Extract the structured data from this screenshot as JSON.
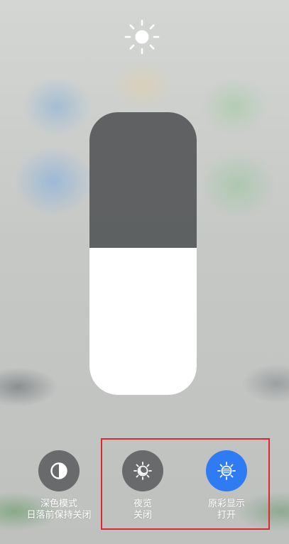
{
  "brightness": {
    "level_fraction": 0.52,
    "icon": "sun-icon"
  },
  "controls": [
    {
      "id": "dark-mode",
      "icon": "dark-mode-icon",
      "title": "深色模式",
      "status": "日落前保持关闭",
      "active": false
    },
    {
      "id": "night-vision",
      "icon": "night-vision-icon",
      "title": "夜览",
      "status": "关闭",
      "active": false
    },
    {
      "id": "true-tone",
      "icon": "true-tone-icon",
      "title": "原彩显示",
      "status": "打开",
      "active": true
    }
  ],
  "colors": {
    "active_button": "#2f7bf3",
    "inactive_button": "#58595c",
    "slider_track": "#505254",
    "slider_fill": "#ffffff",
    "highlight_box": "#e0262e"
  }
}
